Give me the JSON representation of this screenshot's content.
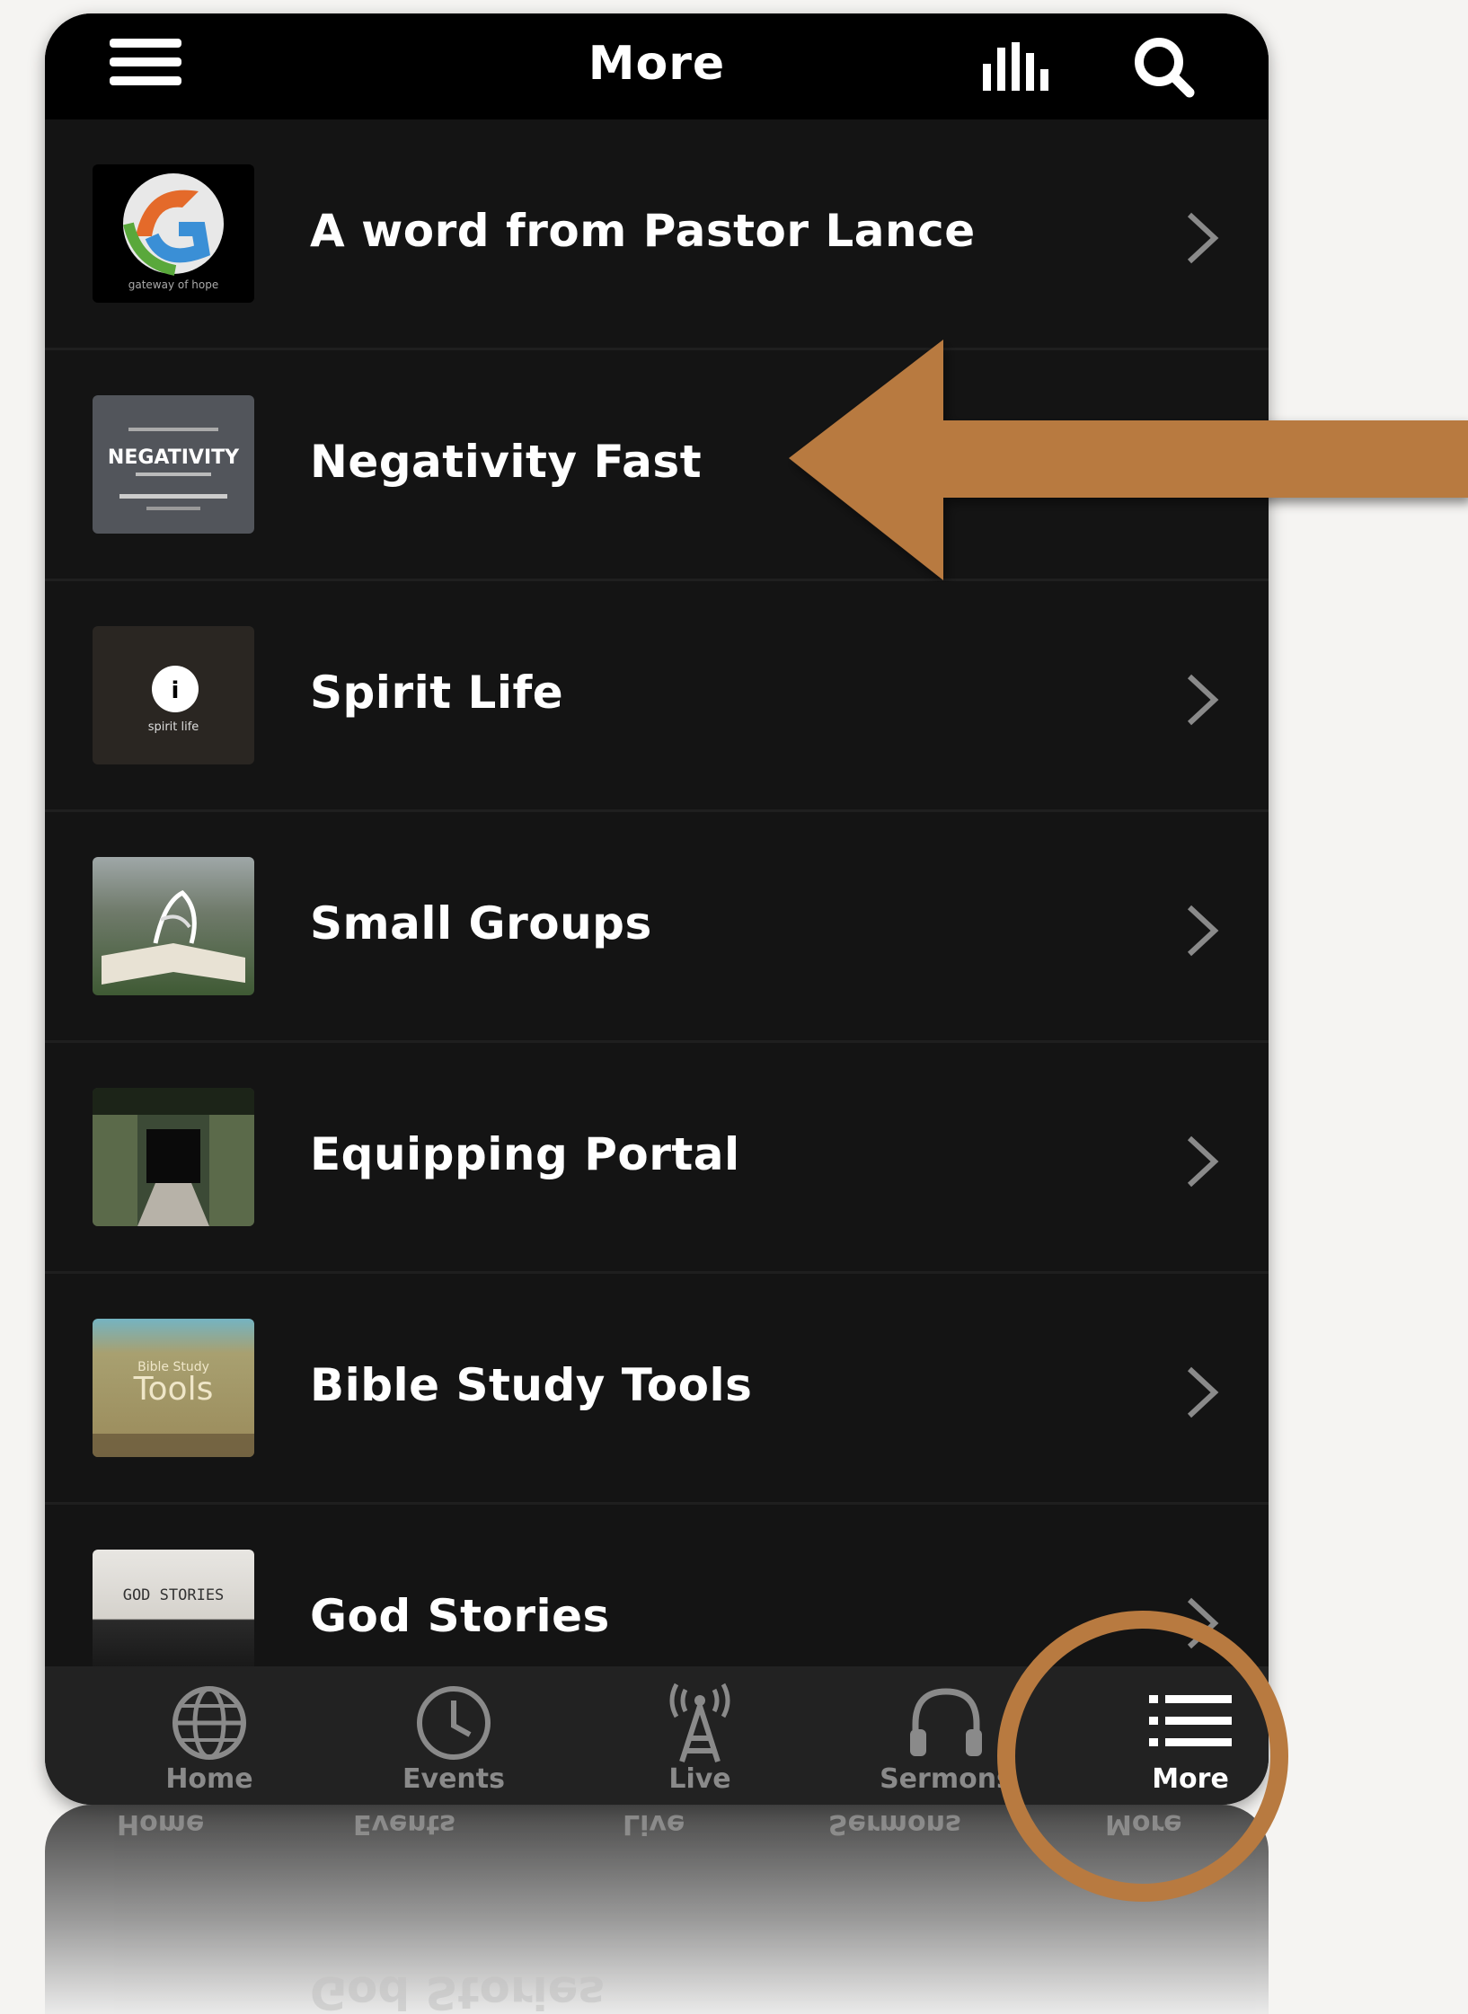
{
  "header": {
    "title": "More"
  },
  "list": {
    "items": [
      {
        "label": "A word from Pastor Lance",
        "thumb_text": "gateway of hope"
      },
      {
        "label": "Negativity Fast",
        "thumb_text": "NEGATIVITY"
      },
      {
        "label": "Spirit Life",
        "thumb_text": "spirit life"
      },
      {
        "label": "Small Groups"
      },
      {
        "label": "Equipping Portal"
      },
      {
        "label": "Bible Study Tools",
        "thumb_text": "Tools",
        "thumb_subtext": "Bible Study"
      },
      {
        "label": "God Stories",
        "thumb_text": "GOD STORIES"
      }
    ]
  },
  "tabbar": {
    "tabs": [
      {
        "label": "Home",
        "icon": "globe-icon"
      },
      {
        "label": "Events",
        "icon": "clock-icon"
      },
      {
        "label": "Live",
        "icon": "antenna-icon"
      },
      {
        "label": "Sermons",
        "icon": "headphones-icon"
      },
      {
        "label": "More",
        "icon": "list-icon",
        "active": true
      }
    ]
  },
  "annotation_color": "#b87a40"
}
